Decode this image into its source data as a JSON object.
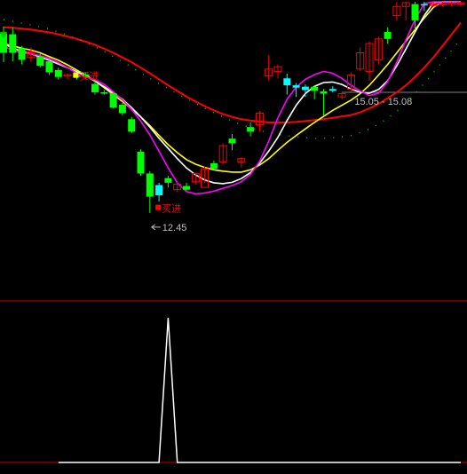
{
  "chart_data": [
    {
      "type": "candlestick",
      "panel": "main",
      "x_index": [
        0,
        1,
        2,
        3,
        4,
        5,
        6,
        7,
        8,
        9,
        10,
        11,
        12,
        13,
        14,
        15,
        16,
        17,
        18,
        19,
        20,
        21,
        22,
        23,
        24,
        25,
        26,
        27,
        28,
        29,
        30,
        31,
        32,
        33,
        34,
        35,
        36,
        37,
        38,
        39,
        40,
        41,
        42,
        43,
        44,
        45,
        46,
        47,
        48,
        49,
        50
      ],
      "ylim": [
        11.3,
        17.0
      ],
      "candles": [
        {
          "o": 16.32,
          "h": 16.47,
          "l": 15.7,
          "c": 15.9,
          "up": false,
          "cyan": false
        },
        {
          "o": 16.3,
          "h": 16.45,
          "l": 15.72,
          "c": 15.9,
          "up": false,
          "cyan": false
        },
        {
          "o": 16.0,
          "h": 16.05,
          "l": 15.65,
          "c": 15.75,
          "up": false,
          "cyan": false
        },
        {
          "o": 15.92,
          "h": 16.02,
          "l": 15.7,
          "c": 15.8,
          "up": true,
          "cyan": false
        },
        {
          "o": 15.82,
          "h": 15.88,
          "l": 15.58,
          "c": 15.62,
          "up": false,
          "cyan": false
        },
        {
          "o": 15.72,
          "h": 15.78,
          "l": 15.42,
          "c": 15.48,
          "up": false,
          "cyan": false
        },
        {
          "o": 15.53,
          "h": 15.58,
          "l": 15.32,
          "c": 15.38,
          "up": false,
          "cyan": false
        },
        {
          "o": 15.43,
          "h": 15.45,
          "l": 15.33,
          "c": 15.4,
          "up": true,
          "cyan": false
        },
        {
          "o": 15.41,
          "h": 15.45,
          "l": 15.32,
          "c": 15.38,
          "up": false,
          "cyan": false
        },
        {
          "o": 15.43,
          "h": 15.48,
          "l": 15.33,
          "c": 15.4,
          "up": false,
          "cyan": false
        },
        {
          "o": 15.23,
          "h": 15.3,
          "l": 15.0,
          "c": 15.05,
          "up": false,
          "cyan": false
        },
        {
          "o": 15.05,
          "h": 15.1,
          "l": 15.0,
          "c": 15.03,
          "up": false,
          "cyan": false
        },
        {
          "o": 15.03,
          "h": 15.05,
          "l": 14.7,
          "c": 14.72,
          "up": false,
          "cyan": false
        },
        {
          "o": 14.78,
          "h": 14.82,
          "l": 14.55,
          "c": 14.6,
          "up": false,
          "cyan": false
        },
        {
          "o": 14.47,
          "h": 14.52,
          "l": 14.17,
          "c": 14.2,
          "up": false,
          "cyan": false
        },
        {
          "o": 13.77,
          "h": 13.82,
          "l": 13.25,
          "c": 13.3,
          "up": false,
          "cyan": false
        },
        {
          "o": 13.3,
          "h": 13.35,
          "l": 12.45,
          "c": 12.8,
          "up": false,
          "cyan": false
        },
        {
          "o": 13.05,
          "h": 13.1,
          "l": 12.7,
          "c": 12.83,
          "up": false,
          "cyan": true
        },
        {
          "o": 13.2,
          "h": 13.25,
          "l": 13.0,
          "c": 13.1,
          "up": false,
          "cyan": false
        },
        {
          "o": 12.95,
          "h": 13.12,
          "l": 12.9,
          "c": 13.07,
          "up": true,
          "cyan": false
        },
        {
          "o": 13.03,
          "h": 13.1,
          "l": 12.93,
          "c": 12.95,
          "up": false,
          "cyan": false
        },
        {
          "o": 13.12,
          "h": 13.32,
          "l": 13.06,
          "c": 13.3,
          "up": true,
          "cyan": false
        },
        {
          "o": 13.0,
          "h": 13.45,
          "l": 13.1,
          "c": 13.4,
          "up": true,
          "cyan": false
        },
        {
          "o": 13.4,
          "h": 13.58,
          "l": 13.38,
          "c": 13.52,
          "up": false,
          "cyan": false
        },
        {
          "o": 13.55,
          "h": 13.95,
          "l": 13.5,
          "c": 13.9,
          "up": true,
          "cyan": false
        },
        {
          "o": 13.95,
          "h": 14.15,
          "l": 13.8,
          "c": 14.05,
          "up": false,
          "cyan": false
        },
        {
          "o": 13.55,
          "h": 13.65,
          "l": 13.43,
          "c": 13.62,
          "up": true,
          "cyan": false
        },
        {
          "o": 14.3,
          "h": 14.4,
          "l": 14.1,
          "c": 14.2,
          "up": false,
          "cyan": false
        },
        {
          "o": 14.35,
          "h": 14.65,
          "l": 14.2,
          "c": 14.6,
          "up": true,
          "cyan": false
        },
        {
          "o": 15.4,
          "h": 15.85,
          "l": 15.3,
          "c": 15.55,
          "up": true,
          "cyan": false
        },
        {
          "o": 15.5,
          "h": 15.65,
          "l": 15.35,
          "c": 15.6,
          "up": true,
          "cyan": false
        },
        {
          "o": 15.35,
          "h": 15.45,
          "l": 15.0,
          "c": 15.2,
          "up": false,
          "cyan": true
        },
        {
          "o": 15.2,
          "h": 15.25,
          "l": 14.95,
          "c": 15.15,
          "up": false,
          "cyan": true
        },
        {
          "o": 15.17,
          "h": 15.22,
          "l": 14.95,
          "c": 15.1,
          "up": false,
          "cyan": true
        },
        {
          "o": 15.17,
          "h": 15.2,
          "l": 14.9,
          "c": 15.08,
          "up": false,
          "cyan": false
        },
        {
          "o": 15.07,
          "h": 15.12,
          "l": 14.55,
          "c": 15.02,
          "up": false,
          "cyan": false
        },
        {
          "o": 15.12,
          "h": 15.18,
          "l": 15.05,
          "c": 15.08,
          "up": false,
          "cyan": true
        },
        {
          "o": 14.95,
          "h": 15.05,
          "l": 14.9,
          "c": 15.02,
          "up": true,
          "cyan": false
        },
        {
          "o": 15.12,
          "h": 15.48,
          "l": 15.05,
          "c": 15.42,
          "up": true,
          "cyan": false
        },
        {
          "o": 15.55,
          "h": 16.02,
          "l": 15.5,
          "c": 15.9,
          "up": true,
          "cyan": false
        },
        {
          "o": 15.5,
          "h": 16.15,
          "l": 15.3,
          "c": 16.1,
          "up": true,
          "cyan": false
        },
        {
          "o": 15.75,
          "h": 16.25,
          "l": 15.65,
          "c": 16.2,
          "up": true,
          "cyan": false
        },
        {
          "o": 16.2,
          "h": 16.45,
          "l": 16.1,
          "c": 16.35,
          "up": false,
          "cyan": false
        },
        {
          "o": 16.7,
          "h": 17.0,
          "l": 16.6,
          "c": 16.9,
          "up": true,
          "cyan": false
        },
        {
          "o": 16.9,
          "h": 17.0,
          "l": 16.6,
          "c": 16.98,
          "up": true,
          "cyan": false
        },
        {
          "o": 16.95,
          "h": 17.0,
          "l": 16.4,
          "c": 16.6,
          "up": false,
          "cyan": false
        },
        {
          "o": 16.95,
          "h": 17.0,
          "l": 16.8,
          "c": 16.92,
          "up": false,
          "cyan": true
        },
        {
          "o": 16.92,
          "h": 17.0,
          "l": 16.9,
          "c": 16.95,
          "up": true,
          "cyan": false
        },
        {
          "o": 16.95,
          "h": 17.0,
          "l": 16.9,
          "c": 16.96,
          "up": true,
          "cyan": false
        },
        {
          "o": 16.96,
          "h": 17.0,
          "l": 16.9,
          "c": 16.97,
          "up": true,
          "cyan": false
        },
        {
          "o": 16.97,
          "h": 17.0,
          "l": 16.9,
          "c": 16.98,
          "up": true,
          "cyan": false
        }
      ],
      "series": [
        {
          "color": "#ff0000",
          "values": [
            16.45,
            16.44,
            16.42,
            16.4,
            16.37,
            16.34,
            16.3,
            16.25,
            16.2,
            16.14,
            16.07,
            15.99,
            15.9,
            15.8,
            15.7,
            15.58,
            15.46,
            15.33,
            15.2,
            15.08,
            14.96,
            14.85,
            14.75,
            14.66,
            14.58,
            14.52,
            14.47,
            14.44,
            14.42,
            14.4,
            14.4,
            14.4,
            14.41,
            14.43,
            14.45,
            14.47,
            14.5,
            14.53,
            14.56,
            14.62,
            14.7,
            14.8,
            14.92,
            15.05,
            15.2,
            15.38,
            15.58,
            15.8,
            16.05,
            16.3,
            16.55
          ]
        },
        {
          "color": "#ffff00",
          "values": [
            16.1,
            16.05,
            16.0,
            15.96,
            15.9,
            15.82,
            15.74,
            15.64,
            15.53,
            15.42,
            15.29,
            15.15,
            15.0,
            14.85,
            14.69,
            14.52,
            14.33,
            14.12,
            13.92,
            13.75,
            13.6,
            13.5,
            13.43,
            13.38,
            13.35,
            13.33,
            13.33,
            13.38,
            13.48,
            13.62,
            13.8,
            13.97,
            14.12,
            14.26,
            14.4,
            14.53,
            14.66,
            14.77,
            14.88,
            15.02,
            15.2,
            15.42,
            15.65,
            15.9,
            16.15,
            16.4,
            16.65,
            16.88,
            17.0,
            17.0,
            17.0
          ]
        },
        {
          "color": "#ffffff",
          "values": [
            16.1,
            16.0,
            15.93,
            15.88,
            15.81,
            15.74,
            15.66,
            15.58,
            15.49,
            15.4,
            15.29,
            15.17,
            15.04,
            14.9,
            14.72,
            14.52,
            14.3,
            14.06,
            13.84,
            13.62,
            13.42,
            13.27,
            13.16,
            13.1,
            13.08,
            13.11,
            13.19,
            13.32,
            13.52,
            13.78,
            14.08,
            14.44,
            14.77,
            15.02,
            15.18,
            15.26,
            15.27,
            15.22,
            15.12,
            15.05,
            15.03,
            15.11,
            15.3,
            15.62,
            15.98,
            16.35,
            16.7,
            16.98,
            17.0,
            17.0,
            17.0
          ]
        },
        {
          "color": "#ff00ff",
          "values": [
            16.05,
            15.95,
            15.9,
            15.88,
            15.84,
            15.78,
            15.69,
            15.58,
            15.46,
            15.38,
            15.32,
            15.22,
            15.06,
            14.89,
            14.68,
            14.43,
            14.13,
            13.78,
            13.42,
            13.1,
            12.91,
            12.86,
            12.88,
            12.92,
            12.98,
            13.04,
            13.12,
            13.28,
            13.56,
            14.0,
            14.5,
            14.9,
            15.16,
            15.33,
            15.43,
            15.5,
            15.46,
            15.35,
            15.2,
            15.08,
            14.98,
            15.03,
            15.28,
            15.7,
            16.18,
            16.62,
            16.96,
            17.0,
            17.0,
            17.0,
            17.0
          ]
        },
        {
          "color": "#00c800",
          "style": "dotted",
          "values": [
            16.62,
            16.58,
            16.54,
            16.5,
            16.46,
            16.41,
            16.35,
            16.28,
            16.21,
            16.12,
            16.03,
            15.93,
            15.82,
            15.71,
            15.59,
            15.47,
            15.35,
            15.24,
            15.13,
            15.02,
            14.91,
            14.81,
            14.71,
            14.61,
            14.52,
            14.43,
            14.35,
            14.29,
            14.23,
            14.18,
            14.14,
            14.11,
            14.09,
            14.07,
            14.06,
            14.06,
            14.07,
            14.09,
            14.12,
            14.18,
            14.26,
            14.36,
            14.49,
            14.64,
            14.82,
            15.02,
            15.24,
            15.47,
            15.71,
            15.95,
            16.2
          ]
        }
      ],
      "reference_line": {
        "value": 15.05,
        "label": "15.05 - 15.08"
      },
      "low_annotation": {
        "x": 16,
        "value": 12.45,
        "label": "12.45"
      },
      "signals": [
        {
          "x": 8,
          "value": 15.4,
          "label": "买进",
          "color": "#ff0000",
          "marker": "#ffff00"
        },
        {
          "x": 17,
          "value": 12.55,
          "label": "买进",
          "color": "#ff0000",
          "marker": "#ff0000"
        }
      ],
      "top_marker": {
        "x": 0,
        "color": "#00c800"
      },
      "up_color": "#ff0000",
      "down_color": "#00ff00",
      "cyan_color": "#00ffff",
      "grid": false
    },
    {
      "type": "line",
      "panel": "indicator",
      "x_start": 6,
      "values": [
        0,
        0,
        0,
        0,
        0,
        0,
        0,
        0,
        0,
        0,
        0,
        0,
        1,
        0,
        0,
        0,
        0,
        0,
        0,
        0,
        0,
        0,
        0,
        0,
        0,
        0,
        0,
        0,
        0,
        0,
        0,
        0,
        0,
        0,
        0,
        0,
        0,
        0,
        0,
        0,
        0,
        0,
        0,
        0,
        0
      ],
      "ylim": [
        0,
        1
      ],
      "color": "#ffffff",
      "grid": false
    }
  ]
}
